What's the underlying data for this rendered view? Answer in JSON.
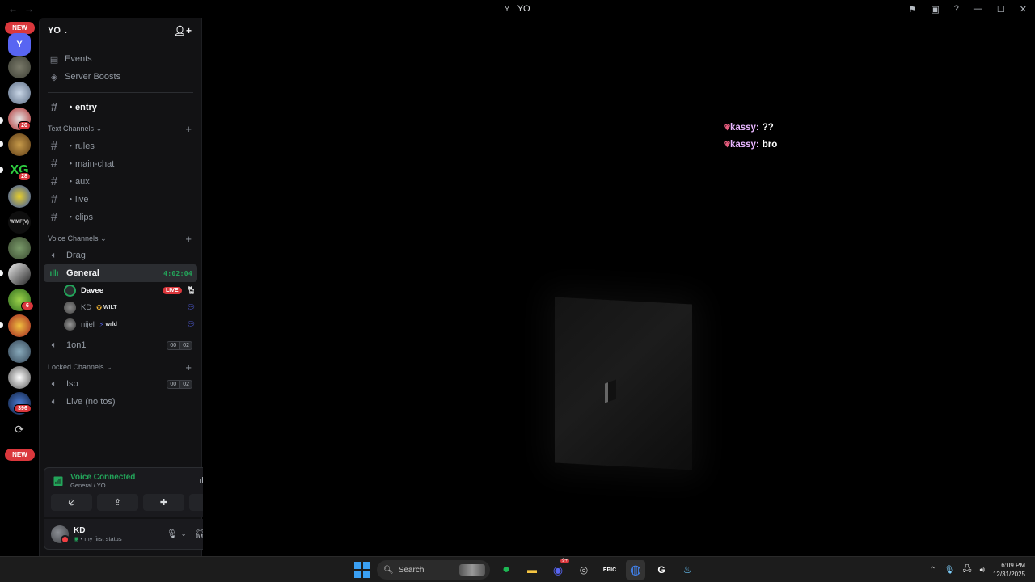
{
  "window": {
    "title": "YO",
    "title_icon_text": "Y"
  },
  "servers": {
    "top_pill": "NEW",
    "bottom_pill": "NEW",
    "badges": [
      "20",
      "28",
      "6",
      "396"
    ],
    "labels": [
      "W.MF(V)"
    ]
  },
  "server_header": {
    "name": "YO"
  },
  "menu": {
    "events": "Events",
    "boosts": "Server Boosts"
  },
  "channels": {
    "entry": "・entry",
    "text_category": "Text Channels",
    "text": [
      "・rules",
      "・main-chat",
      "・aux",
      "・live",
      "・clips"
    ],
    "voice_category": "Voice Channels",
    "drag": "Drag",
    "general": "General",
    "general_timer": "4:02:04",
    "voice_users": [
      {
        "name": "Davee",
        "live": "LIVE"
      },
      {
        "name": "KD",
        "tag": "WILT"
      },
      {
        "name": "nijel",
        "tag": "wrld"
      }
    ],
    "one_on_one": "1on1",
    "one_on_one_count": [
      "00",
      "02"
    ],
    "locked_category": "Locked Channels",
    "iso": "Iso",
    "iso_count": [
      "00",
      "02"
    ],
    "live_no_tos": "Live (no tos)"
  },
  "voice_panel": {
    "title": "Voice Connected",
    "subtitle": "General / YO"
  },
  "user_panel": {
    "name": "KD",
    "status": "my first status"
  },
  "stage": {
    "chat": [
      {
        "user": "kassy:",
        "text": "??"
      },
      {
        "user": "kassy:",
        "text": "bro"
      }
    ]
  },
  "taskbar": {
    "search_placeholder": "Search",
    "time": "6:09 PM",
    "date": "12/31/2025",
    "discord_badge": "9+"
  },
  "colors": {
    "accent_green": "#23a55a",
    "danger_red": "#da373c",
    "blurple": "#5865f2"
  }
}
